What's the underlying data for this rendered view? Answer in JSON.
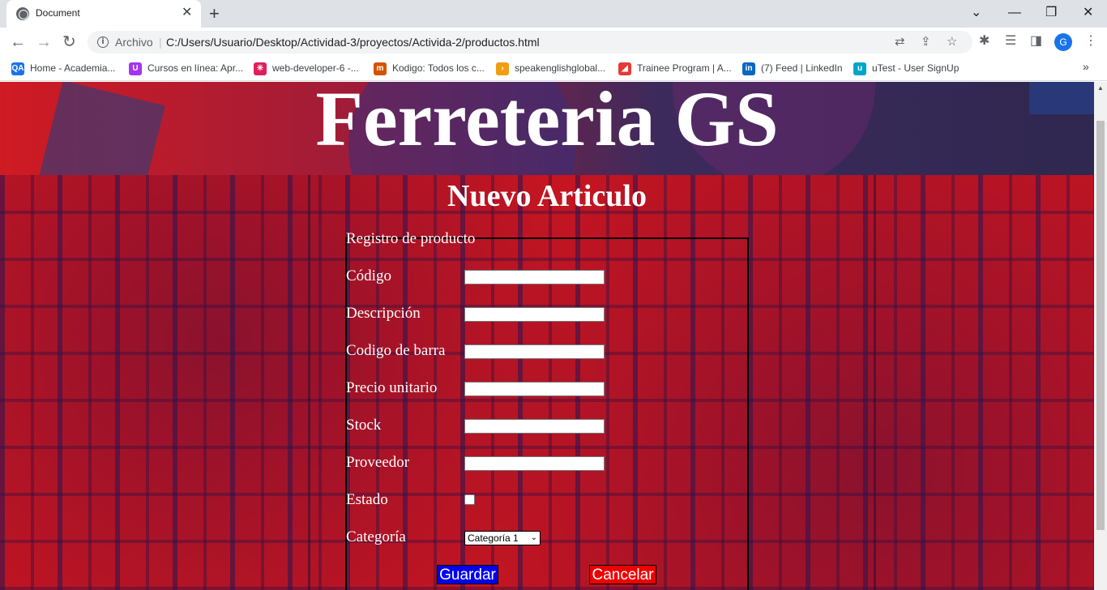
{
  "browser": {
    "tab_title": "Document",
    "tab_close": "✕",
    "new_tab": "+",
    "window_controls": {
      "minimize": "—",
      "restore": "❐",
      "close": "✕",
      "tab_search": "⌄"
    },
    "nav": {
      "back": "←",
      "forward": "→",
      "reload": "↻"
    },
    "address": {
      "scheme_label": "Archivo",
      "separator": "|",
      "url": "C:/Users/Usuario/Desktop/Actividad-3/proyectos/Activida-2/productos.html"
    },
    "omnibox_icons": {
      "translate": "⇄",
      "share": "⇪",
      "bookmark_star": "☆"
    },
    "extension_icons": {
      "extensions": "✱",
      "reading_list": "☰",
      "side_panel": "◨",
      "menu": "⋮"
    },
    "profile_initial": "G",
    "bookmarks": [
      {
        "label": "Home - Academia...",
        "icon": "QA",
        "color": "#1a73e8"
      },
      {
        "label": "Cursos en línea: Apr...",
        "icon": "U",
        "color": "#a435f0"
      },
      {
        "label": "web-developer-6 -...",
        "icon": "✳",
        "color": "#e01e5a"
      },
      {
        "label": "Kodigo: Todos los c...",
        "icon": "m",
        "color": "#d35400"
      },
      {
        "label": "speakenglishglobal...",
        "icon": "›",
        "color": "#f39c12"
      },
      {
        "label": "Trainee Program | A...",
        "icon": "◢",
        "color": "#e53935"
      },
      {
        "label": "(7) Feed | LinkedIn",
        "icon": "in",
        "color": "#0a66c2"
      },
      {
        "label": "uTest - User SignUp",
        "icon": "u",
        "color": "#00a5c8"
      }
    ],
    "bookmarks_more": "»",
    "scroll_up": "▲"
  },
  "page": {
    "site_title": "Ferreteria GS",
    "heading": "Nuevo Articulo",
    "form": {
      "legend": "Registro de producto",
      "fields": [
        {
          "label": "Código",
          "type": "text",
          "value": ""
        },
        {
          "label": "Descripción",
          "type": "text",
          "value": ""
        },
        {
          "label": "Codigo de barra",
          "type": "text",
          "value": ""
        },
        {
          "label": "Precio unitario",
          "type": "text",
          "value": ""
        },
        {
          "label": "Stock",
          "type": "text",
          "value": ""
        },
        {
          "label": "Proveedor",
          "type": "text",
          "value": ""
        },
        {
          "label": "Estado",
          "type": "checkbox",
          "checked": false
        },
        {
          "label": "Categoría",
          "type": "select",
          "selected": "Categoría 1"
        }
      ],
      "select_caret": "⌄",
      "save_label": "Guardar",
      "cancel_label": "Cancelar",
      "save_color": "#0000ee",
      "cancel_color": "#ee0000"
    }
  }
}
